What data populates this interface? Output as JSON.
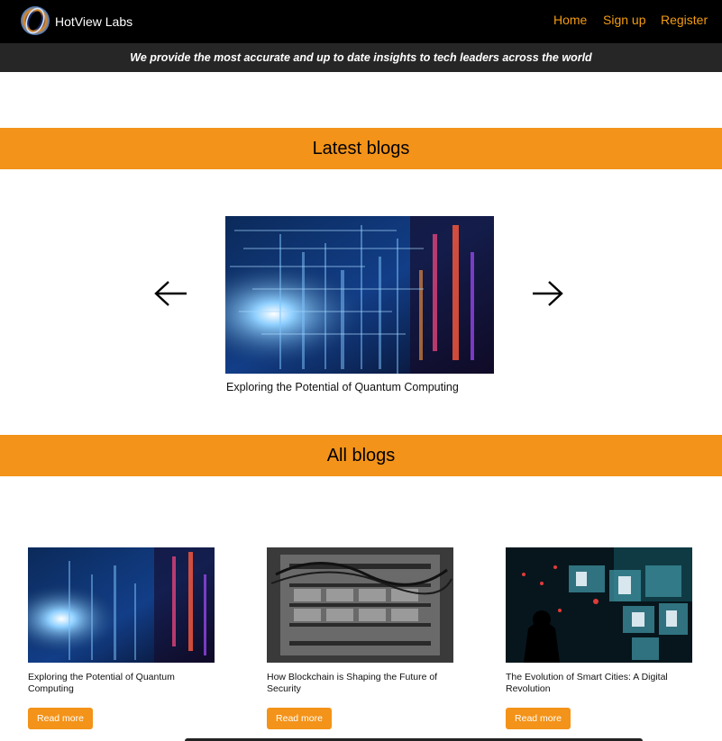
{
  "header": {
    "brand": "HotView Labs",
    "nav": {
      "home": "Home",
      "signup": "Sign up",
      "register": "Register"
    }
  },
  "tagline": "We provide the most accurate and up to date insights to tech leaders across the world",
  "latest": {
    "heading": "Latest blogs",
    "featured_title": "Exploring the Potential of Quantum Computing"
  },
  "all": {
    "heading": "All blogs",
    "cards": [
      {
        "title": "Exploring the Potential of Quantum Computing",
        "button": "Read more"
      },
      {
        "title": "How Blockchain is Shaping the Future of Security",
        "button": "Read more"
      },
      {
        "title": "The Evolution of Smart Cities: A Digital Revolution",
        "button": "Read more"
      }
    ]
  },
  "colors": {
    "accent": "#f39319",
    "nav_bg": "#000000",
    "tagline_bg": "#262626"
  }
}
